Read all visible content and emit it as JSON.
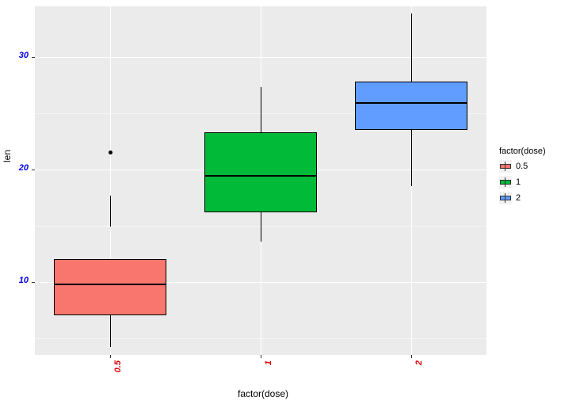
{
  "chart_data": {
    "type": "box",
    "xlabel": "factor(dose)",
    "ylabel": "len",
    "categories": [
      "0.5",
      "1",
      "2"
    ],
    "y_ticks": [
      10,
      20,
      30
    ],
    "ylim": [
      3.5,
      34.5
    ],
    "series": [
      {
        "name": "0.5",
        "color": "#F8766D",
        "min": 4.2,
        "q1": 7.0,
        "median": 9.85,
        "q3": 12.0,
        "max": 17.7,
        "outliers": [
          21.5
        ]
      },
      {
        "name": "1",
        "color": "#00BA38",
        "min": 13.6,
        "q1": 16.2,
        "median": 19.5,
        "q3": 23.3,
        "max": 27.3,
        "outliers": []
      },
      {
        "name": "2",
        "color": "#619CFF",
        "min": 18.5,
        "q1": 23.5,
        "median": 26.0,
        "q3": 27.8,
        "max": 33.9,
        "outliers": []
      }
    ],
    "legend": {
      "title": "factor(dose)",
      "labels": [
        "0.5",
        "1",
        "2"
      ],
      "colors": [
        "#F8766D",
        "#00BA38",
        "#619CFF"
      ]
    }
  }
}
